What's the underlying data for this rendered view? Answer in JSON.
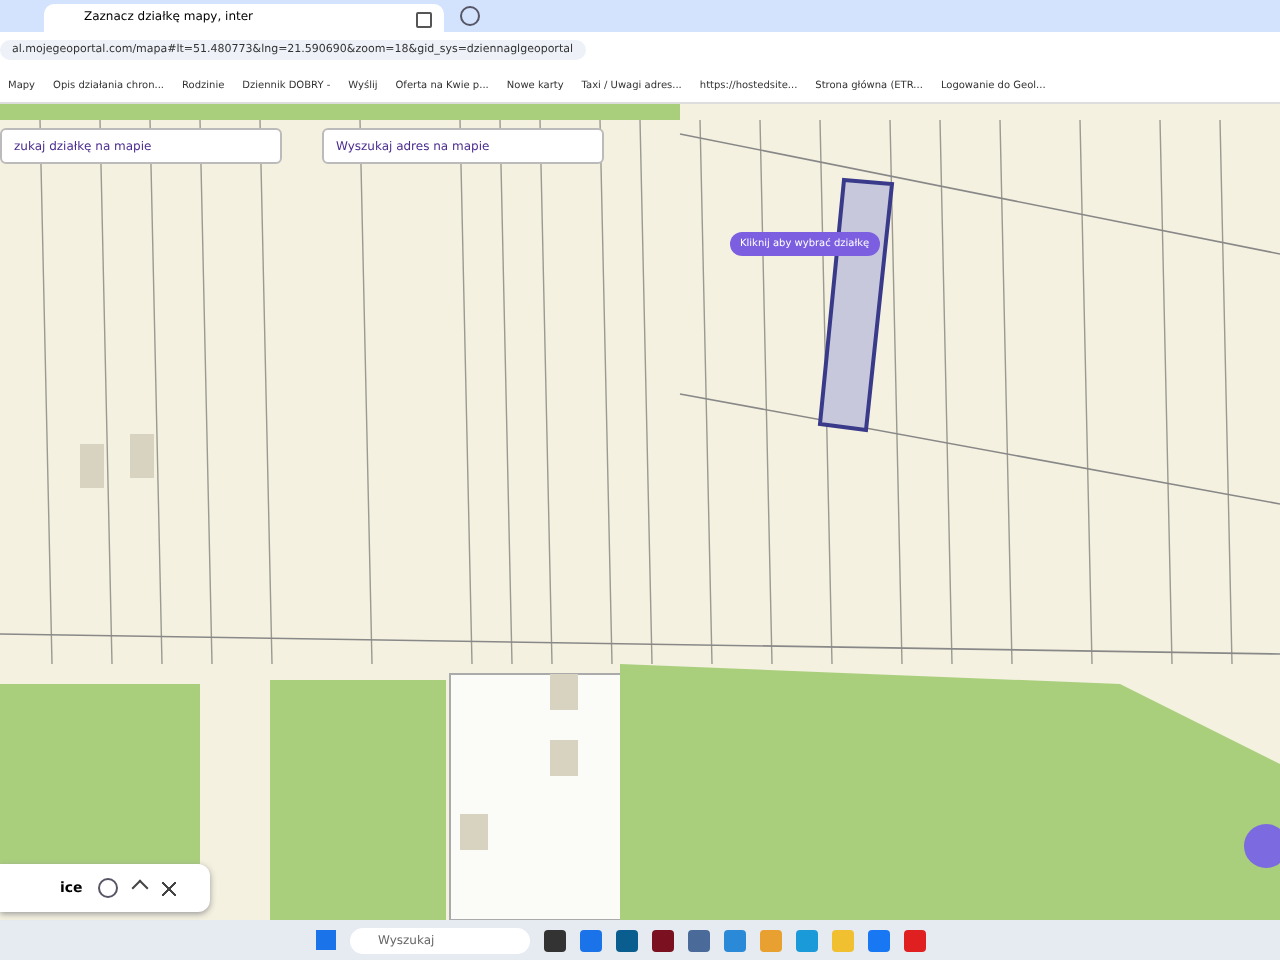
{
  "browser": {
    "tab_title": "Zaznacz działkę mapy, inter",
    "url": "al.mojegeoportal.com/mapa#lt=51.480773&lng=21.590690&zoom=18&gid_sys=dziennaglgeoportal",
    "bookmarks": [
      "Mapy",
      "Opis działania chron...",
      "Rodzinie",
      "Dziennik DOBRY -",
      "Wyślij",
      "Oferta na Kwie p...",
      "Nowe karty",
      "Taxi / Uwagi adres...",
      "https://hostedsite...",
      "Strona główna (ETR...",
      "Logowanie do Geol..."
    ]
  },
  "map": {
    "search_buttons": [
      "zukaj działkę na mapie",
      "Wyszukaj adres na mapie"
    ],
    "tooltip": "Kliknij aby wybrać działkę",
    "find_bar": {
      "text": "ice"
    }
  },
  "taskbar": {
    "search_placeholder": "Wyszukaj"
  }
}
